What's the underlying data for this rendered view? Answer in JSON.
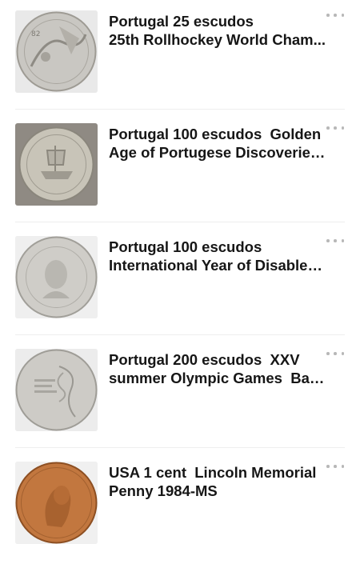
{
  "items": [
    {
      "title_line1": "Portugal 25 escudos",
      "title_line2": "25th Rollhockey World Cham...",
      "more_icon": "more-horizontal-icon",
      "coin_color": "#c9c7c2"
    },
    {
      "title_line1": "Portugal 100 escudos  Golden",
      "title_line2": "Age of Portugese Discoveries...",
      "more_icon": "more-horizontal-icon",
      "coin_color": "#c8c4b8"
    },
    {
      "title_line1": "Portugal 100 escudos",
      "title_line2": "International Year of Disabled...",
      "more_icon": "more-horizontal-icon",
      "coin_color": "#cfcdc8"
    },
    {
      "title_line1": "Portugal 200 escudos  XXV",
      "title_line2": "summer Olympic Games  Bar...",
      "more_icon": "more-horizontal-icon",
      "coin_color": "#cdcbc6"
    },
    {
      "title_line1": "USA 1 cent  Lincoln Memorial",
      "title_line2": "Penny 1984-MS",
      "more_icon": "more-horizontal-icon",
      "coin_color": "#c2773f"
    }
  ]
}
